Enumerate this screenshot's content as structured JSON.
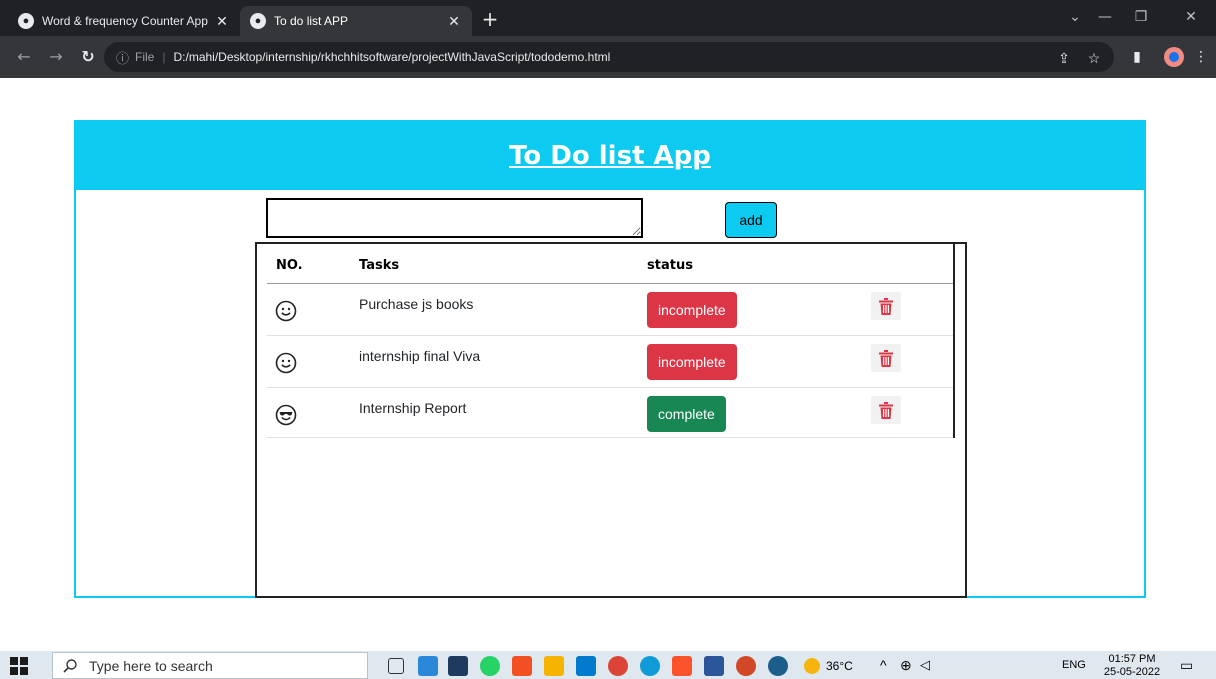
{
  "browser": {
    "tabs": [
      {
        "title": "Word & frequency Counter App",
        "active": false
      },
      {
        "title": "To do list APP",
        "active": true
      }
    ],
    "address": {
      "scheme": "File",
      "url": "D:/mahi/Desktop/internship/rkhchhitsoftware/projectWithJavaScript/tododemo.html"
    }
  },
  "app": {
    "title": "To Do list App",
    "input": {
      "value": "",
      "placeholder": ""
    },
    "add_label": "add",
    "table": {
      "headers": [
        "NO.",
        "Tasks",
        "status"
      ],
      "rows": [
        {
          "icon": "smile-icon",
          "task": "Purchase js books",
          "status": "incomplete"
        },
        {
          "icon": "smile-icon",
          "task": "internship final Viva",
          "status": "incomplete"
        },
        {
          "icon": "cool-face-icon",
          "task": "Internship Report",
          "status": "complete"
        }
      ]
    },
    "colors": {
      "accent": "#0dcaf0",
      "danger": "#dc3545",
      "success": "#198754"
    }
  },
  "taskbar": {
    "search_placeholder": "Type here to search",
    "weather": "36°C",
    "language": "ENG",
    "time": "01:57 PM",
    "date": "25-05-2022"
  }
}
